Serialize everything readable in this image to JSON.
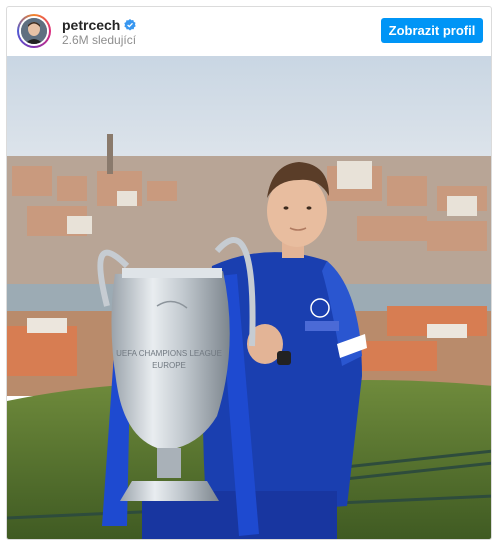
{
  "post": {
    "username": "petrcech",
    "verified": true,
    "followers": "2.6M sledující",
    "view_profile_label": "Zobrazit profil"
  },
  "photo": {
    "subject": "man holding large silver trophy with blue ribbons in front of city view",
    "trophy_text": "UEFA CHAMPIONS LEAGUE EUROPE"
  },
  "icons": {
    "verified": "verified-badge-icon"
  },
  "colors": {
    "accent": "#0095f6",
    "verified": "#3897f0",
    "jacket": "#1a3fb0"
  }
}
